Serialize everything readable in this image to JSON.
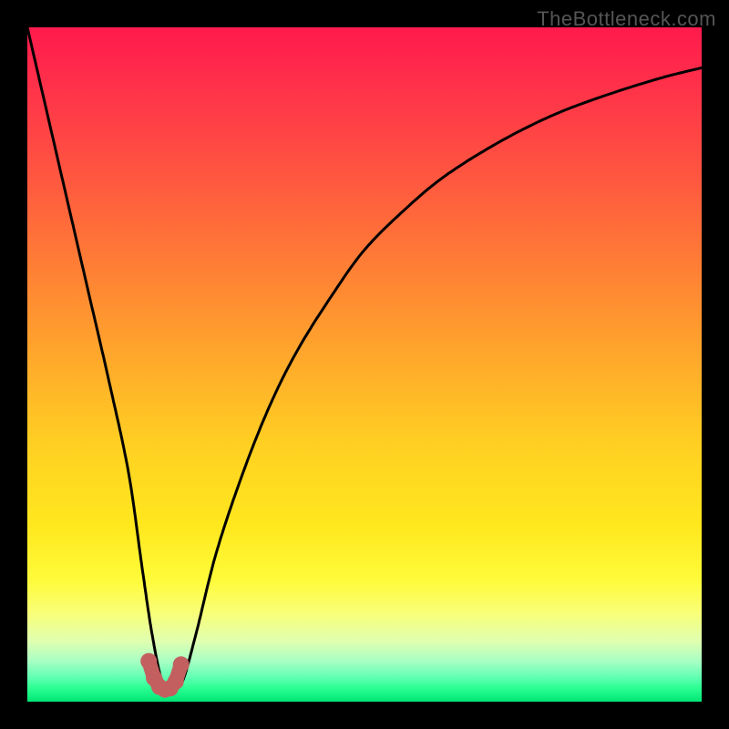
{
  "watermark": "TheBottleneck.com",
  "chart_data": {
    "type": "line",
    "title": "",
    "xlabel": "",
    "ylabel": "",
    "xlim": [
      0,
      100
    ],
    "ylim": [
      0,
      100
    ],
    "grid": false,
    "legend": false,
    "series": [
      {
        "name": "bottleneck-curve",
        "color": "#000000",
        "x": [
          0,
          3,
          6,
          9,
          12,
          15,
          17,
          18.5,
          20,
          21.5,
          23,
          25,
          28,
          32,
          36,
          40,
          45,
          50,
          56,
          62,
          70,
          78,
          86,
          94,
          100
        ],
        "y": [
          100,
          87,
          74,
          61,
          48,
          34,
          20,
          10,
          3,
          2,
          3,
          10,
          22,
          34,
          44,
          52,
          60,
          67,
          73,
          78,
          83,
          87,
          90,
          92.5,
          94
        ]
      }
    ],
    "annotations": [
      {
        "name": "trough-marker",
        "type": "marker-cluster",
        "color": "#c3605f",
        "points": [
          {
            "x": 18.0,
            "y": 6.0
          },
          {
            "x": 18.8,
            "y": 3.5
          },
          {
            "x": 19.6,
            "y": 2.2
          },
          {
            "x": 20.4,
            "y": 1.8
          },
          {
            "x": 21.2,
            "y": 2.0
          },
          {
            "x": 22.0,
            "y": 3.0
          },
          {
            "x": 22.8,
            "y": 5.5
          }
        ]
      }
    ],
    "background_gradient": {
      "orientation": "vertical",
      "stops": [
        {
          "pos": 0.0,
          "color": "#ff1a4d"
        },
        {
          "pos": 0.08,
          "color": "#ff2f4a"
        },
        {
          "pos": 0.22,
          "color": "#ff5640"
        },
        {
          "pos": 0.34,
          "color": "#ff7a36"
        },
        {
          "pos": 0.48,
          "color": "#ffa52c"
        },
        {
          "pos": 0.62,
          "color": "#ffd022"
        },
        {
          "pos": 0.74,
          "color": "#ffe81e"
        },
        {
          "pos": 0.82,
          "color": "#fffb3a"
        },
        {
          "pos": 0.87,
          "color": "#f8ff7a"
        },
        {
          "pos": 0.91,
          "color": "#e0ffb0"
        },
        {
          "pos": 0.94,
          "color": "#a8ffc4"
        },
        {
          "pos": 0.965,
          "color": "#5dffb2"
        },
        {
          "pos": 0.98,
          "color": "#2bff91"
        },
        {
          "pos": 1.0,
          "color": "#00e676"
        }
      ]
    }
  }
}
